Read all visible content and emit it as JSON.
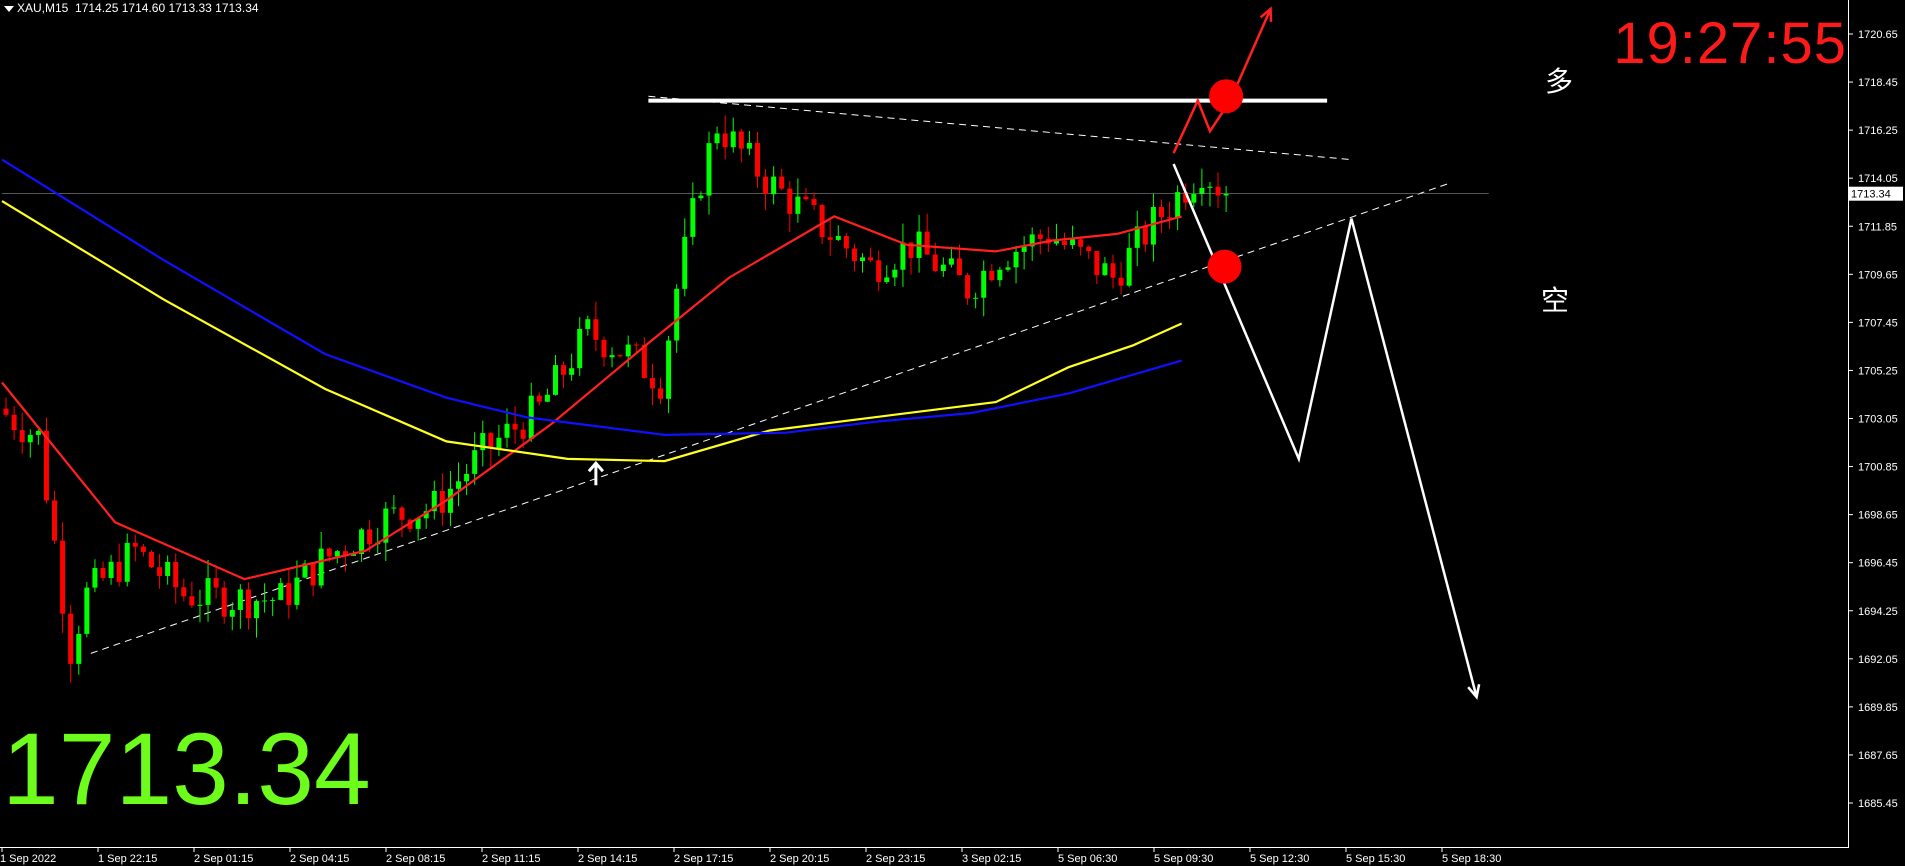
{
  "header": {
    "symbol": "XAU,M15",
    "ohlc": "1714.25 1714.60 1713.33 1713.34"
  },
  "clock": "19:27:55",
  "current_price": "1713.34",
  "annotations": {
    "long": "多",
    "short": "空"
  },
  "colors": {
    "background": "#000000",
    "bull": "#00ff00",
    "bear": "#ff0000",
    "ma_fast": "#ff2020",
    "ma_mid": "#ffff20",
    "ma_slow": "#1010ff",
    "clock": "#ff1a1a",
    "big_price": "#6dfc1c",
    "axis_text": "#ffffff"
  },
  "chart_data": {
    "type": "candlestick",
    "symbol": "XAU",
    "timeframe": "M15",
    "y_ticks": [
      "1720.65",
      "1718.45",
      "1716.25",
      "1714.05",
      "1711.85",
      "1709.65",
      "1707.45",
      "1705.25",
      "1703.05",
      "1700.85",
      "1698.65",
      "1696.45",
      "1694.25",
      "1692.05",
      "1689.85",
      "1687.65",
      "1685.45"
    ],
    "ylim": [
      1685.0,
      1721.3
    ],
    "current_price": 1713.34,
    "x_ticks": [
      "1 Sep 2022",
      "1 Sep 22:15",
      "2 Sep 01:15",
      "2 Sep 04:15",
      "2 Sep 08:15",
      "2 Sep 11:15",
      "2 Sep 14:15",
      "2 Sep 17:15",
      "2 Sep 20:15",
      "2 Sep 23:15",
      "3 Sep 02:15",
      "5 Sep 06:30",
      "5 Sep 09:30",
      "5 Sep 12:30",
      "5 Sep 15:30",
      "5 Sep 18:30"
    ],
    "candle_count": 152,
    "close_path": [
      [
        0,
        1703.5
      ],
      [
        5,
        1702.2
      ],
      [
        9,
        1692.5
      ],
      [
        11,
        1695
      ],
      [
        17,
        1697
      ],
      [
        23,
        1695
      ],
      [
        29,
        1694.8
      ],
      [
        35,
        1694.8
      ],
      [
        40,
        1696.5
      ],
      [
        48,
        1698.5
      ],
      [
        54,
        1699
      ],
      [
        60,
        1701.5
      ],
      [
        67,
        1703.5
      ],
      [
        73,
        1707
      ],
      [
        78,
        1706
      ],
      [
        82,
        1704.8
      ],
      [
        84,
        1709
      ],
      [
        87,
        1714
      ],
      [
        89,
        1716.5
      ],
      [
        95,
        1714
      ],
      [
        103,
        1711.5
      ],
      [
        108,
        1710
      ],
      [
        113,
        1711
      ],
      [
        120,
        1709
      ],
      [
        124,
        1710.5
      ],
      [
        130,
        1711.5
      ],
      [
        138,
        1709.5
      ],
      [
        143,
        1712
      ],
      [
        149,
        1714.5
      ],
      [
        152,
        1713.34
      ]
    ],
    "moving_averages": [
      {
        "name": "MA fast",
        "color": "#ff2020",
        "points": [
          [
            0,
            1704.7
          ],
          [
            14,
            1698.3
          ],
          [
            30,
            1695.7
          ],
          [
            45,
            1697
          ],
          [
            55,
            1699.3
          ],
          [
            68,
            1702.8
          ],
          [
            80,
            1706.5
          ],
          [
            90,
            1709.5
          ],
          [
            103,
            1712.3
          ],
          [
            112,
            1711
          ],
          [
            123,
            1710.7
          ],
          [
            130,
            1711.2
          ],
          [
            138,
            1711.5
          ],
          [
            146,
            1712.3
          ]
        ]
      },
      {
        "name": "MA mid",
        "color": "#ffff20",
        "points": [
          [
            0,
            1713
          ],
          [
            20,
            1708.5
          ],
          [
            40,
            1704.4
          ],
          [
            55,
            1702
          ],
          [
            70,
            1701.2
          ],
          [
            82,
            1701.1
          ],
          [
            95,
            1702.5
          ],
          [
            110,
            1703.2
          ],
          [
            123,
            1703.8
          ],
          [
            132,
            1705.4
          ],
          [
            140,
            1706.4
          ],
          [
            146,
            1707.4
          ]
        ]
      },
      {
        "name": "MA slow",
        "color": "#1010ff",
        "points": [
          [
            0,
            1714.9
          ],
          [
            20,
            1710.3
          ],
          [
            40,
            1706
          ],
          [
            55,
            1704
          ],
          [
            65,
            1703.1
          ],
          [
            82,
            1702.3
          ],
          [
            97,
            1702.4
          ],
          [
            108,
            1702.9
          ],
          [
            120,
            1703.3
          ],
          [
            132,
            1704.2
          ],
          [
            146,
            1705.7
          ]
        ]
      }
    ],
    "trendlines": [
      {
        "style": "dashed",
        "from": [
          11,
          1692.3
        ],
        "to": [
          179,
          1713.8
        ]
      },
      {
        "style": "dashed",
        "from": [
          80,
          1717.8
        ],
        "to": [
          167,
          1714.9
        ]
      },
      {
        "style": "solid",
        "color": "#ffffff",
        "from": [
          80,
          1717.6
        ],
        "to": [
          164,
          1717.6
        ]
      },
      {
        "style": "solid",
        "color": "#aaaaaa",
        "width": 0.5,
        "from": [
          0,
          1713.34
        ],
        "to": [
          184,
          1713.34
        ]
      }
    ],
    "arrows": [
      {
        "color": "#ff2020",
        "points": [
          [
            145,
            1715.2
          ],
          [
            148,
            1717.6
          ],
          [
            149.5,
            1716.2
          ],
          [
            152,
            1717.6
          ],
          [
            157,
            1721.8
          ]
        ]
      },
      {
        "color": "#ffffff",
        "points": [
          [
            145,
            1714.7
          ],
          [
            160.5,
            1701.2
          ],
          [
            167,
            1712.2
          ],
          [
            182.5,
            1690.3
          ]
        ]
      }
    ],
    "markers": [
      {
        "shape": "dot",
        "color": "#ff0000",
        "at": [
          151.5,
          1717.8
        ],
        "label": "多"
      },
      {
        "shape": "dot",
        "color": "#ff0000",
        "at": [
          151.3,
          1710.0
        ],
        "label": "空"
      },
      {
        "shape": "up-arrow",
        "color": "#ffffff",
        "at": [
          73.5,
          1700.5
        ]
      }
    ]
  }
}
